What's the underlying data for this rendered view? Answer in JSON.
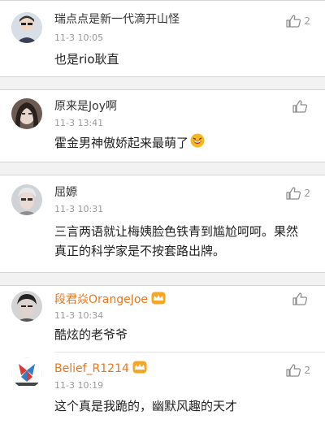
{
  "comments": [
    {
      "name": "瑞点点是新一代滴开山怪",
      "time": "11-3 10:05",
      "text": "也是rio耿直",
      "likes": "2",
      "icon": "thumbs-up-icon"
    },
    {
      "name": "原来是Joy啊",
      "time": "11-3 13:41",
      "text": "霍金男神傲娇起来最萌了",
      "likes": "",
      "icon": "thumbs-up-icon"
    },
    {
      "name": "屈嫄",
      "time": "11-3 10:31",
      "text": "三言两语就让梅姨脸色铁青到尴尬呵呵。果然真正的科学家是不按套路出牌。",
      "likes": "2",
      "icon": "thumbs-up-icon"
    },
    {
      "name": "段君焱OrangeJoe",
      "time": "11-3 10:34",
      "text": "酷炫的老爷爷",
      "likes": "",
      "icon": "thumbs-up-icon"
    },
    {
      "name": "Belief_R1214",
      "time": "11-3 10:19",
      "text": "这个真是我跪的，幽默风趣的天才",
      "likes": "2",
      "icon": "thumbs-up-icon"
    }
  ],
  "colors": {
    "vip_name": "#e8761f",
    "muted": "#9a9a9a",
    "gap": "#f2f2f2"
  }
}
